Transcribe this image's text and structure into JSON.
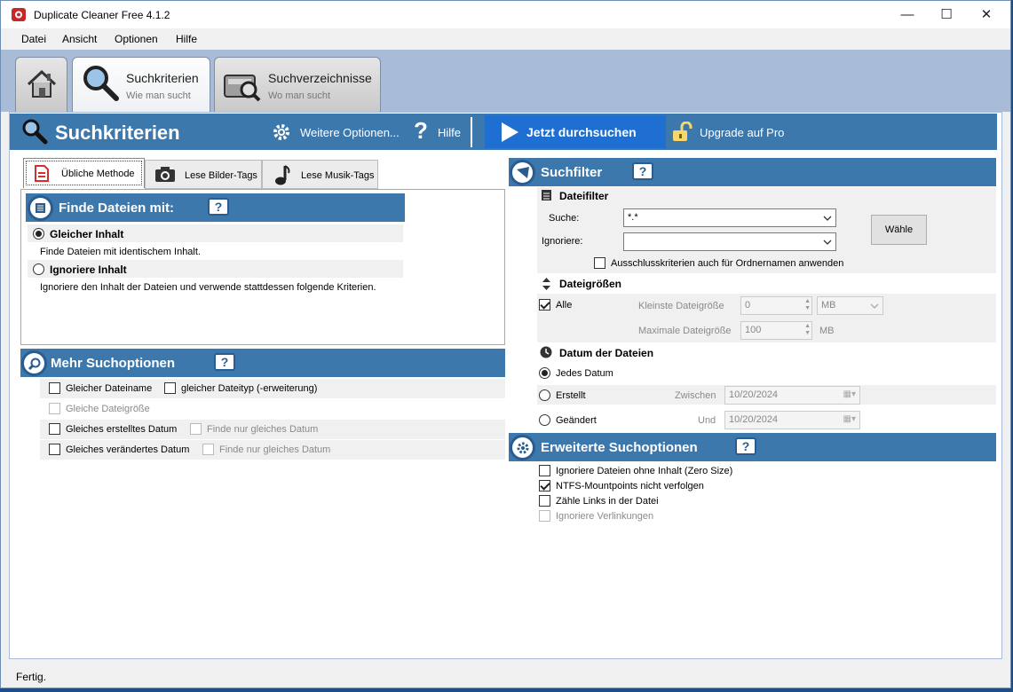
{
  "window": {
    "title": "Duplicate Cleaner Free 4.1.2",
    "minimize": "—",
    "maximize": "☐",
    "close": "✕"
  },
  "menu": [
    "Datei",
    "Ansicht",
    "Optionen",
    "Hilfe"
  ],
  "tabs": [
    {
      "label": "",
      "sub": "",
      "icon": "home-icon"
    },
    {
      "label": "Suchkriterien",
      "sub": "Wie man sucht",
      "icon": "magnifier-icon"
    },
    {
      "label": "Suchverzeichnisse",
      "sub": "Wo man sucht",
      "icon": "drive-search-icon"
    }
  ],
  "header": {
    "title": "Suchkriterien",
    "more_options": "Weitere Optionen...",
    "help": "Hilfe",
    "scan": "Jetzt durchsuchen",
    "upgrade": "Upgrade auf Pro"
  },
  "method_tabs": [
    "Übliche Methode",
    "Lese Bilder-Tags",
    "Lese Musik-Tags"
  ],
  "find": {
    "title": "Finde Dateien mit:",
    "help": "?",
    "same_content": "Gleicher Inhalt",
    "same_content_desc": "Finde Dateien mit identischem Inhalt.",
    "ignore_content": "Ignoriere Inhalt",
    "ignore_content_desc": "Ignoriere den Inhalt der Dateien und verwende stattdessen folgende Kriterien."
  },
  "more": {
    "title": "Mehr Suchoptionen",
    "help": "?",
    "same_name": "Gleicher Dateiname",
    "same_type": "gleicher Dateityp (-erweiterung)",
    "same_size": "Gleiche Dateigröße",
    "same_created": "Gleiches erstelltes Datum",
    "same_created_only": "Finde nur gleiches Datum",
    "same_modified": "Gleiches verändertes Datum",
    "same_modified_only": "Finde nur gleiches Datum"
  },
  "filter": {
    "title": "Suchfilter",
    "help": "?",
    "file_filter": "Dateifilter",
    "search_label": "Suche:",
    "search_value": "*.*",
    "ignore_label": "Ignoriere:",
    "ignore_value": "",
    "choose": "Wähle",
    "exclude_folders": "Ausschlusskriterien auch für Ordnernamen anwenden",
    "sizes_title": "Dateigrößen",
    "all": "Alle",
    "min_label": "Kleinste Dateigröße",
    "min_value": "0",
    "min_unit": "MB",
    "max_label": "Maximale Dateigröße",
    "max_value": "100",
    "max_unit": "MB",
    "dates_title": "Datum der Dateien",
    "any_date": "Jedes Datum",
    "created": "Erstellt",
    "between": "Zwischen",
    "created_date": "10/20/2024",
    "modified": "Geändert",
    "and": "Und",
    "modified_date": "10/20/2024"
  },
  "advanced": {
    "title": "Erweiterte Suchoptionen",
    "help": "?",
    "zero_size": "Ignoriere Dateien ohne Inhalt (Zero Size)",
    "ntfs": "NTFS-Mountpoints nicht verfolgen",
    "count_links": "Zähle Links in der Datei",
    "ignore_links": "Ignoriere Verlinkungen"
  },
  "status": "Fertig."
}
